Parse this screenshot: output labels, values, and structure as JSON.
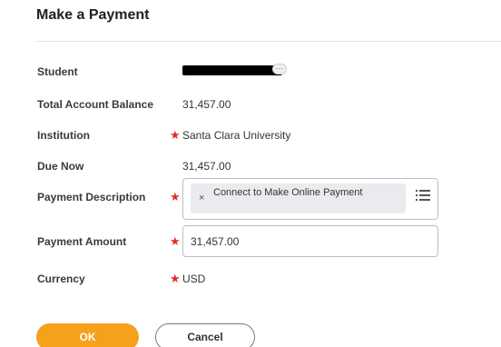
{
  "page": {
    "title": "Make a Payment"
  },
  "fields": {
    "student": {
      "label": "Student",
      "more_glyph": "···"
    },
    "total_balance": {
      "label": "Total Account Balance",
      "value": "31,457.00"
    },
    "institution": {
      "label": "Institution",
      "required_mark": "★",
      "value": "Santa Clara University"
    },
    "due_now": {
      "label": "Due Now",
      "value": "31,457.00"
    },
    "payment_description": {
      "label": "Payment Description",
      "required_mark": "★",
      "remove_glyph": "×",
      "selected": "Connect to Make Online Payment",
      "prompt_icon": "list-icon"
    },
    "payment_amount": {
      "label": "Payment Amount",
      "required_mark": "★",
      "value": "31,457.00"
    },
    "currency": {
      "label": "Currency",
      "required_mark": "★",
      "value": "USD"
    }
  },
  "actions": {
    "ok_label": "OK",
    "cancel_label": "Cancel"
  },
  "colors": {
    "required": "#de2e21",
    "ok_button": "#f5a11c",
    "pill_bg": "#e9ebee",
    "border": "#bdbdbd"
  }
}
